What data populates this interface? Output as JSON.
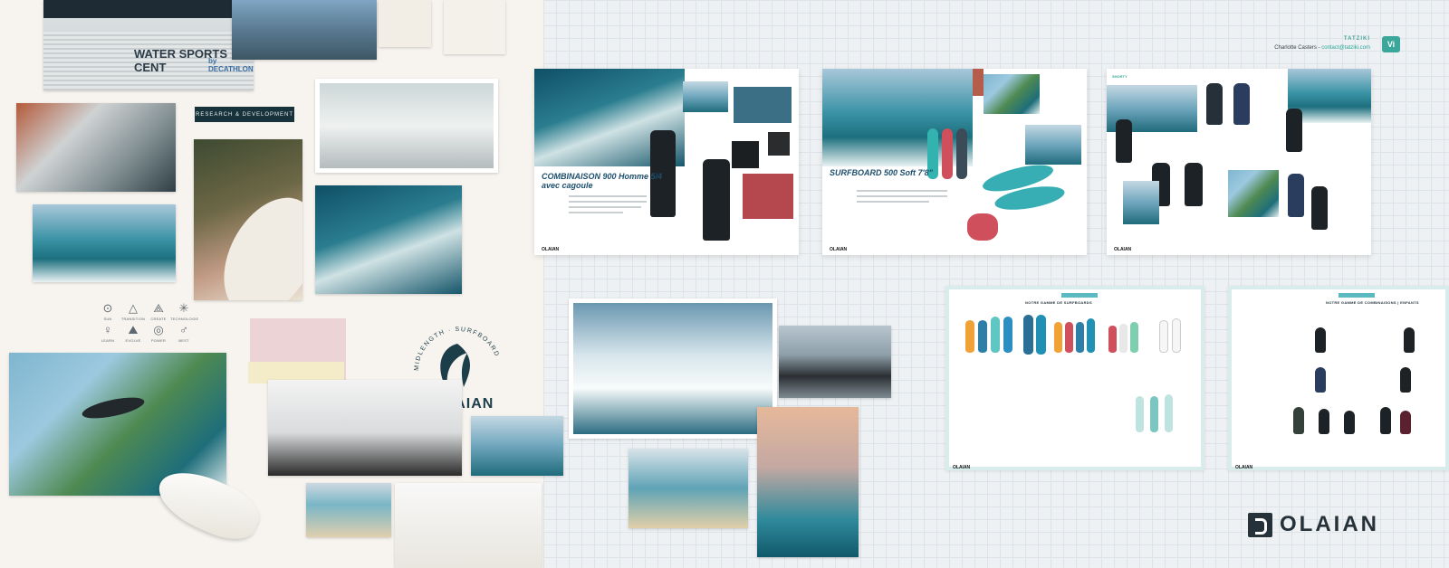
{
  "left_board": {
    "banner_text": "WATER SPORTS CENT",
    "banner_sub": "by DECATHLON",
    "rd_badge": "RESEARCH & DEVELOPMENT",
    "icons": [
      {
        "glyph": "⊙",
        "label": "SUN",
        "name": "sun-icon"
      },
      {
        "glyph": "△",
        "label": "TRANSITION",
        "name": "transition-icon"
      },
      {
        "glyph": "⟁",
        "label": "CREATE",
        "name": "create-icon"
      },
      {
        "glyph": "✳",
        "label": "TECHNOLOGIE",
        "name": "technology-icon"
      },
      {
        "glyph": "♀",
        "label": "LEARN",
        "name": "learn-icon"
      },
      {
        "glyph": "⛰",
        "label": "EVOLVE",
        "name": "evolve-icon"
      },
      {
        "glyph": "◎",
        "label": "POWER",
        "name": "power-icon"
      },
      {
        "glyph": "♂",
        "label": "BEST",
        "name": "best-icon"
      }
    ],
    "midlength_text": "MIDLENGTH · SURFBOARD",
    "brand_name": "OLAIAN"
  },
  "spreads": {
    "wetsuit": {
      "title": "COMBINAISON 900 Homme 5/4 avec cagoule",
      "footer": "OLAIAN"
    },
    "surfboard": {
      "title": "SURFBOARD 500 Soft 7'8\"",
      "footer": "OLAIAN"
    },
    "shorty": {
      "title": "SHORTY",
      "footer": "OLAIAN"
    }
  },
  "header_right": {
    "agency": "TATZIKI",
    "contact_name": "Charlotte Casters - ",
    "contact_email": "contact@tatziki.com",
    "agency_logo": "Vi"
  },
  "catalogs": {
    "boards_title": "NOTRE GAMME DE SURFBOARDS",
    "wetsuits_title": "NOTRE GAMME DE COMBINAISONS | ENFANTS",
    "footer": "OLAIAN"
  },
  "brand_logo_bottom": "OLAIAN",
  "colors": {
    "accent_teal": "#3aa79a",
    "navy": "#17323a",
    "title_blue": "#1c4f6d"
  }
}
